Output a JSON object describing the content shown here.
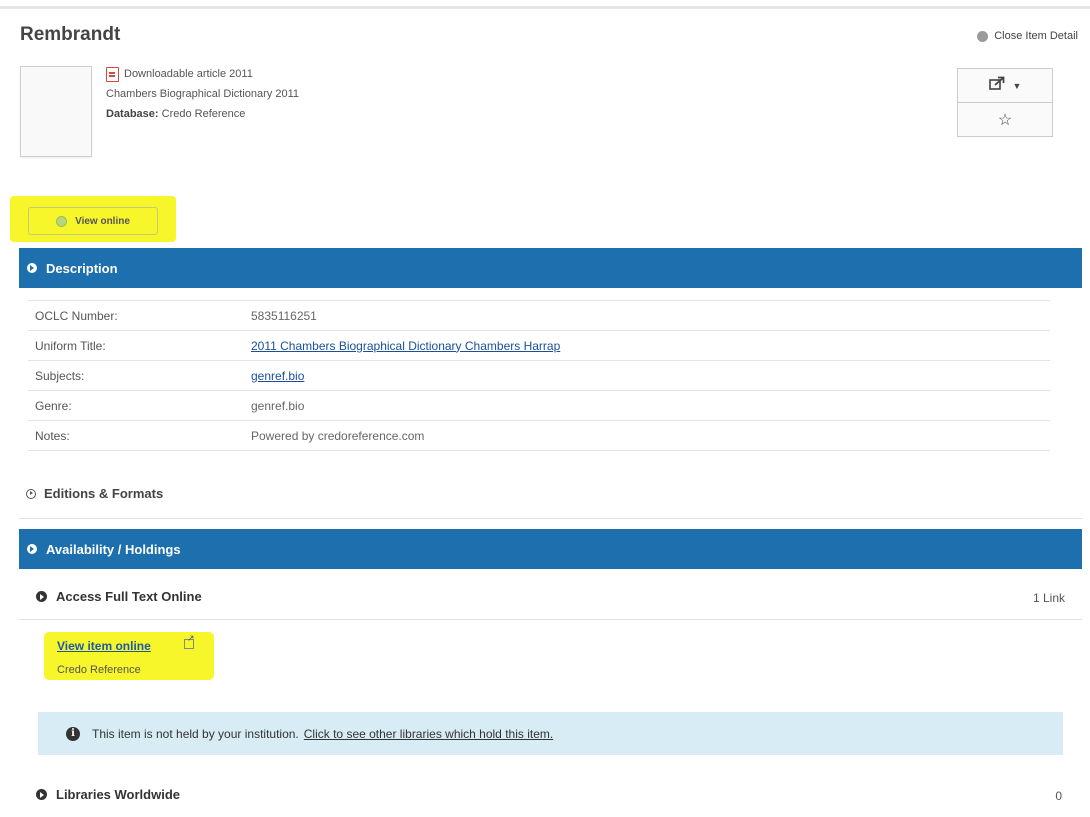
{
  "record": {
    "title": "Rembrandt",
    "close_label": "Close Item Detail",
    "format": "Downloadable article 2011",
    "source": "Chambers Biographical Dictionary 2011",
    "database_label": "Database:",
    "database_value": "Credo Reference"
  },
  "actions": {
    "share_icon": "share-icon",
    "star_icon": "star-icon",
    "view_online_label": "View online"
  },
  "description": {
    "header": "Description",
    "rows": [
      {
        "label": "OCLC Number:",
        "value": "5835116251"
      },
      {
        "label": "Uniform Title:",
        "value": "2011 Chambers Biographical Dictionary Chambers Harrap"
      },
      {
        "label": "Subjects:",
        "value": "genref.bio"
      },
      {
        "label": "Genre:",
        "value": "genref.bio"
      },
      {
        "label": "Notes:",
        "value": "Powered by credoreference.com"
      }
    ]
  },
  "editions": {
    "label": "Editions & Formats"
  },
  "availability": {
    "header": "Availability / Holdings",
    "access_label": "Access Full Text Online",
    "access_count": "1 Link",
    "view_item_online": "View item online",
    "provider": "Credo Reference",
    "info_text": "This item is not held by your institution.",
    "info_link": "Click to see other libraries which hold this item.",
    "worldwide_label": "Libraries Worldwide",
    "worldwide_count": "0"
  },
  "colors": {
    "header_blue": "#1d70ad",
    "highlight_yellow": "#f6f62a",
    "info_bg": "#d7ecf4"
  }
}
